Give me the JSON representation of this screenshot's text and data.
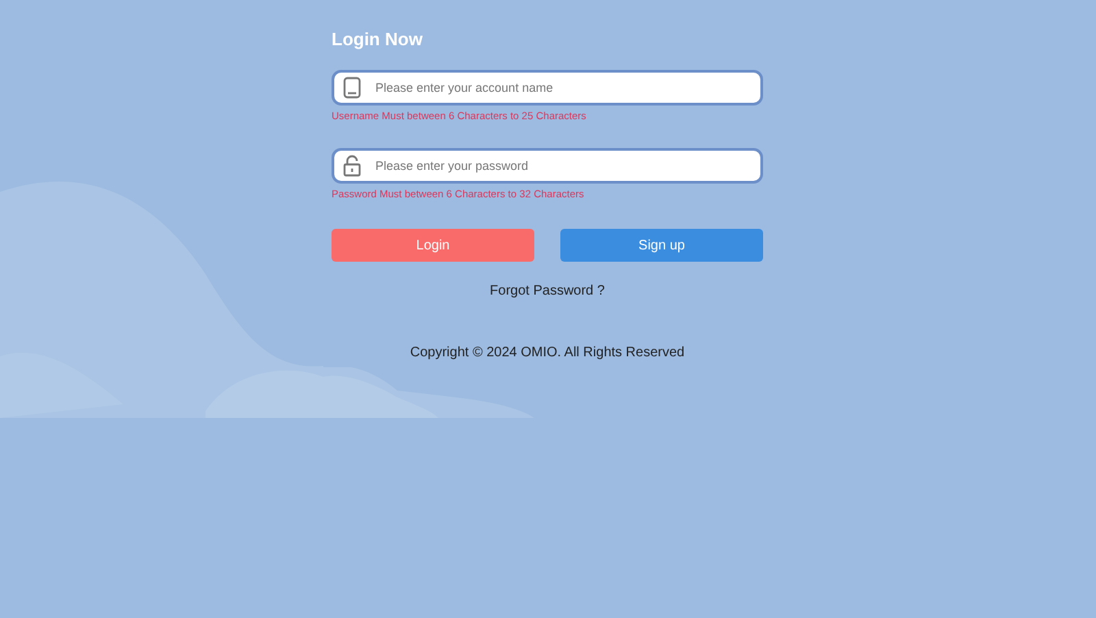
{
  "title": "Login Now",
  "fields": [
    {
      "kind": "account",
      "placeholder": "Please enter your account name",
      "error": "Username Must between 6 Characters to 25 Characters"
    },
    {
      "kind": "password",
      "placeholder": "Please enter your password",
      "error": "Password Must between 6 Characters to 32 Characters"
    }
  ],
  "buttons": [
    {
      "kind": "login",
      "label": "Login"
    },
    {
      "kind": "signup",
      "label": "Sign up"
    }
  ],
  "forgot_link": "Forgot Password ?",
  "copyright": "Copyright © 2024 OMIO. All Rights Reserved"
}
